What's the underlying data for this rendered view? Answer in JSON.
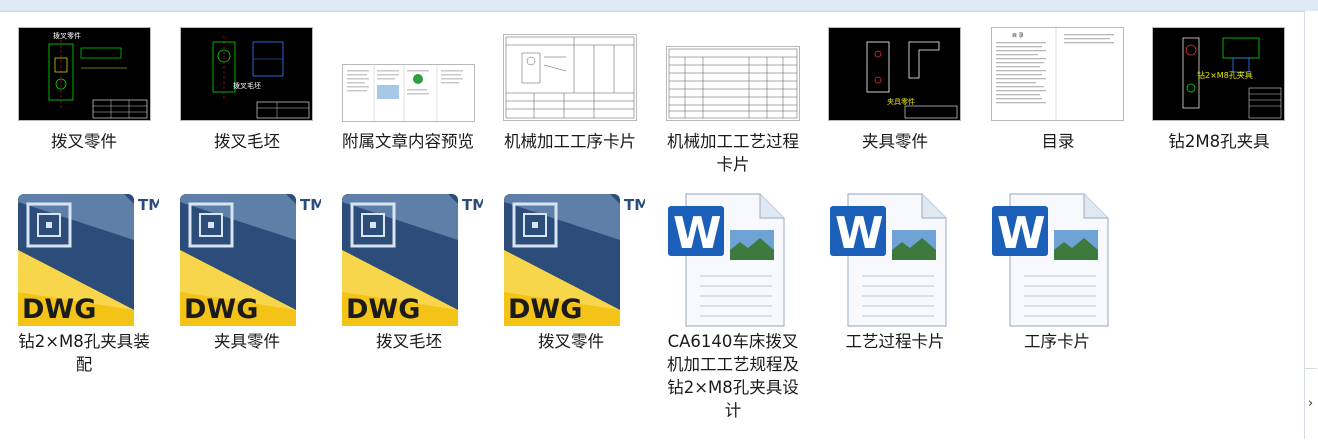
{
  "files_row1": [
    {
      "label": "拨叉零件",
      "preview_text": "拨叉零件"
    },
    {
      "label": "拨叉毛坯",
      "preview_text": "拨叉毛坯"
    },
    {
      "label": "附属文章内容预览"
    },
    {
      "label": "机械加工工序卡片"
    },
    {
      "label": "机械加工工艺过程卡片"
    },
    {
      "label": "夹具零件",
      "preview_text": "夹具零件"
    },
    {
      "label": "目录",
      "preview_text": "目 录"
    },
    {
      "label": "钻2M8孔夹具",
      "preview_text": "钻2×M8孔夹具"
    }
  ],
  "files_row2": [
    {
      "label": "钻2×M8孔夹具装配",
      "type": "DWG",
      "badge": "DWG",
      "tm": "TM"
    },
    {
      "label": "夹具零件",
      "type": "DWG",
      "badge": "DWG",
      "tm": "TM"
    },
    {
      "label": "拨叉毛坯",
      "type": "DWG",
      "badge": "DWG",
      "tm": "TM"
    },
    {
      "label": "拨叉零件",
      "type": "DWG",
      "badge": "DWG",
      "tm": "TM"
    },
    {
      "label": "CA6140车床拨叉机加工工艺规程及钻2×M8孔夹具设计",
      "type": "Word"
    },
    {
      "label": "工艺过程卡片",
      "type": "Word"
    },
    {
      "label": "工序卡片",
      "type": "Word"
    }
  ],
  "icons": {
    "dwg": "autocad-dwg-file-icon",
    "word": "word-document-icon",
    "expander": "chevron-right-icon"
  },
  "colors": {
    "cad_bg": "#000000",
    "dwg_yellow": "#f4c318",
    "dwg_blue": "#2c4d7a",
    "word_blue": "#1c5fb8"
  },
  "expander_glyph": "›"
}
